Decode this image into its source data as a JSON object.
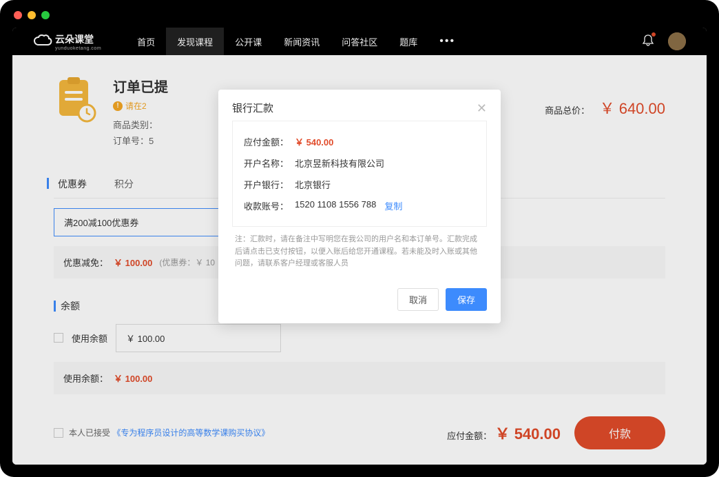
{
  "brand": {
    "name": "云朵课堂",
    "sub": "yunduoketang.com"
  },
  "nav": {
    "items": [
      "首页",
      "发现课程",
      "公开课",
      "新闻资讯",
      "问答社区",
      "题库"
    ],
    "active_index": 1
  },
  "order": {
    "title": "订单已提",
    "warning": "请在2",
    "category_label": "商品类别：",
    "number_label": "订单号：5",
    "total_label": "商品总价：",
    "total_value": "￥ 640.00"
  },
  "coupon_section": {
    "tabs": [
      "优惠券",
      "积分"
    ],
    "selected": "满200减100优惠券",
    "discount_label": "优惠减免：",
    "discount_value": "￥ 100.00",
    "discount_note": "(优惠券：￥ 10"
  },
  "balance_section": {
    "title": "余额",
    "checkbox_label": "使用余额",
    "input_value": "￥ 100.00",
    "used_label": "使用余额：",
    "used_value": "￥ 100.00"
  },
  "agreement": {
    "prefix": "本人已接受",
    "link": "《专为程序员设计的高等数学课购买协议》"
  },
  "footer": {
    "payable_label": "应付金额：",
    "payable_value": "￥ 540.00",
    "pay_button": "付款"
  },
  "modal": {
    "title": "银行汇款",
    "rows": [
      {
        "label": "应付金额：",
        "value": "￥ 540.00",
        "is_amount": true
      },
      {
        "label": "开户名称：",
        "value": "北京昱新科技有限公司"
      },
      {
        "label": "开户银行：",
        "value": "北京银行"
      },
      {
        "label": "收款账号：",
        "value": "1520 1108 1556 788",
        "has_copy": true
      }
    ],
    "copy_text": "复制",
    "note": "注：汇款时，请在备注中写明您在我公司的用户名和本订单号。汇款完成后请点击已支付按钮，以便入账后给您开通课程。若未能及时入账或其他问题，请联系客户经理或客服人员",
    "cancel": "取消",
    "save": "保存"
  }
}
